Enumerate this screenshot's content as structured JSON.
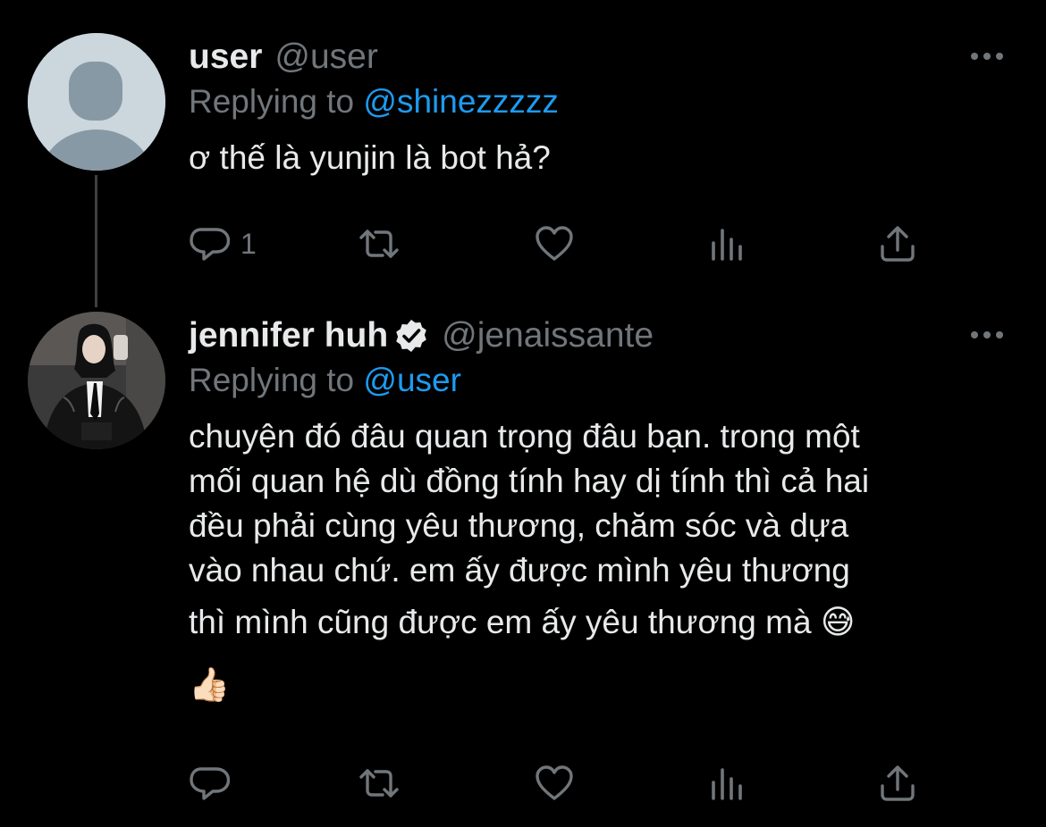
{
  "tweets": [
    {
      "name": "user",
      "handle": "@user",
      "reply_prefix": "Replying to ",
      "reply_to": "@shinezzzzz",
      "text_lines": [
        "ơ thế là yunjin là bot hả?"
      ],
      "avatar_icon": "default-avatar-icon",
      "verified": false,
      "actions": {
        "reply_count": "1",
        "retweet_count": "",
        "like_count": "",
        "views_count": ""
      }
    },
    {
      "name": "jennifer huh",
      "handle": "@jenaissante",
      "reply_prefix": "Replying to ",
      "reply_to": "@user",
      "text_lines": [
        "chuyện đó đâu quan trọng đâu bạn. trong một",
        "mối quan hệ dù đồng tính hay dị tính thì cả hai",
        "đều phải cùng yêu thương, chăm sóc và dựa",
        "vào nhau chứ. em ấy được mình yêu thương",
        "thì mình cũng được em ấy yêu thương mà 😅",
        "👍🏻"
      ],
      "avatar_icon": "profile-photo",
      "verified": true,
      "actions": {
        "reply_count": "",
        "retweet_count": "",
        "like_count": "",
        "views_count": ""
      }
    }
  ],
  "icons": {
    "reply": "reply-icon",
    "retweet": "retweet-icon",
    "like": "like-icon",
    "views": "views-icon",
    "share": "share-icon",
    "more": "more-icon",
    "verified": "verified-badge-icon"
  },
  "colors": {
    "background": "#000000",
    "text": "#e7e9ea",
    "secondary": "#71767b",
    "link": "#1d9bf0",
    "thread_line": "#3e4144"
  }
}
